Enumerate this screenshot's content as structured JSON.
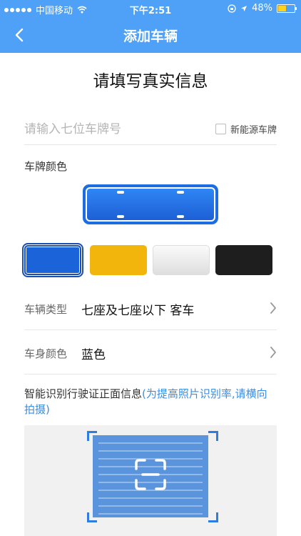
{
  "status_bar": {
    "carrier": "中国移动",
    "time": "下午2:51",
    "battery_percent": "48%",
    "battery_level": 0.48,
    "icons": [
      "signal-dots-icon",
      "wifi-icon",
      "rotation-lock-icon",
      "location-arrow-icon",
      "battery-icon"
    ]
  },
  "nav": {
    "title": "添加车辆",
    "back_icon": "chevron-left-icon"
  },
  "page_title": "请填写真实信息",
  "plate_input": {
    "placeholder": "请输入七位车牌号",
    "value": ""
  },
  "new_energy": {
    "label": "新能源车牌",
    "checked": false
  },
  "plate_color": {
    "label": "车牌颜色",
    "selected": "blue",
    "options": [
      {
        "name": "blue",
        "color": "#1b63d9"
      },
      {
        "name": "yellow",
        "color": "#f1b50c"
      },
      {
        "name": "white",
        "color": "#f0f0f0"
      },
      {
        "name": "black",
        "color": "#1e1e1e"
      }
    ]
  },
  "vehicle_type": {
    "label": "车辆类型",
    "value": "七座及七座以下 客车"
  },
  "body_color": {
    "label": "车身颜色",
    "value": "蓝色"
  },
  "scan_info": {
    "text": "智能识别行驶证正面信息",
    "hint": "(为提高照片识别率,请横向拍摄)"
  },
  "colors": {
    "accent": "#4ea1f6",
    "link": "#3a8ee6"
  }
}
